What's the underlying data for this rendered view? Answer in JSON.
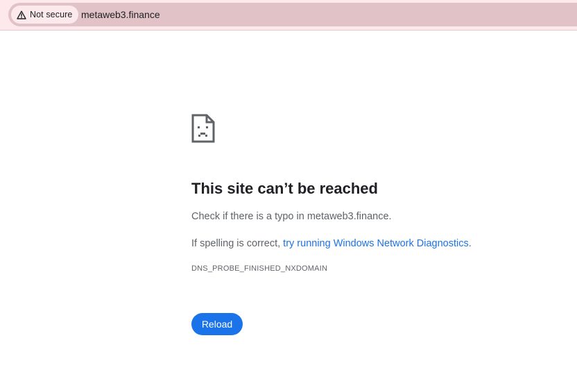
{
  "address_bar": {
    "security_label": "Not secure",
    "security_icon": "warning-triangle-icon",
    "url": "metaweb3.finance"
  },
  "error_page": {
    "icon": "sad-page-icon",
    "title": "This site can’t be reached",
    "check_line": "Check if there is a typo in metaweb3.finance.",
    "suggestion_prefix": "If spelling is correct, ",
    "suggestion_link": "try running Windows Network Diagnostics",
    "suggestion_suffix": ".",
    "error_code": "DNS_PROBE_FINISHED_NXDOMAIN",
    "reload_label": "Reload"
  },
  "colors": {
    "toolbar_background": "#fde8ec",
    "omnibox_background": "#e0c2c7",
    "link": "#1a73e8",
    "button": "#1a73e8"
  }
}
